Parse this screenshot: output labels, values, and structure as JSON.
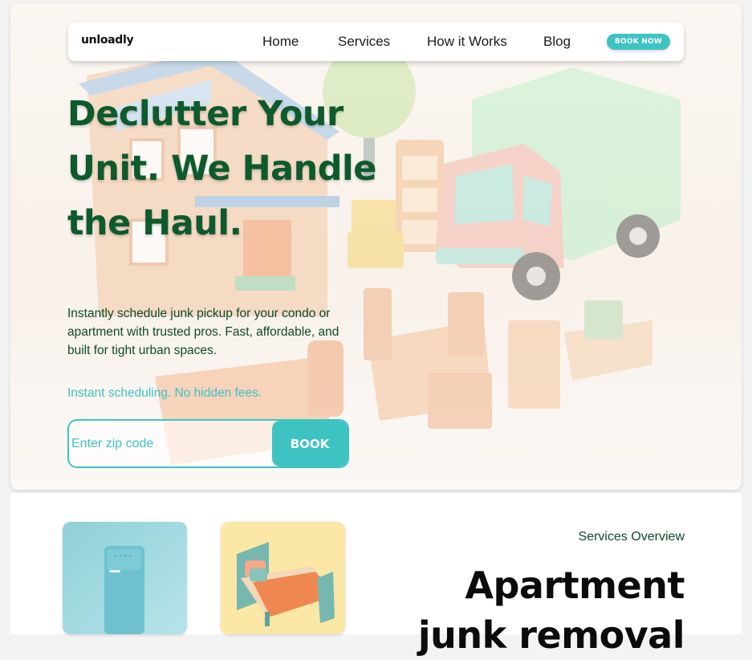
{
  "nav": {
    "logo": "unloadly",
    "links": [
      "Home",
      "Services",
      "How it Works",
      "Blog"
    ],
    "cta": "BOOK NOW"
  },
  "hero": {
    "headline_lines": [
      "Declutter Your",
      "Unit. We Handle",
      "the Haul."
    ],
    "subtitle": "Instantly schedule junk pickup for your condo or apartment with trusted pros. Fast, affordable, and built for tight urban spaces.",
    "tagline": "Instant scheduling. No hidden fees.",
    "zip_placeholder": "Enter zip code",
    "book_label": "BOOK"
  },
  "services": {
    "label": "Services Overview",
    "title": "Apartment junk removal",
    "cards": [
      {
        "image": "teal refrigerator",
        "icon": "fridge-image"
      },
      {
        "image": "bed with orange blanket",
        "icon": "bed-image"
      }
    ]
  },
  "colors": {
    "accent": "#3ec3c3",
    "headline": "#0d5a2c",
    "subtitle": "#0d4a26",
    "dark": "#0b0b0b"
  }
}
